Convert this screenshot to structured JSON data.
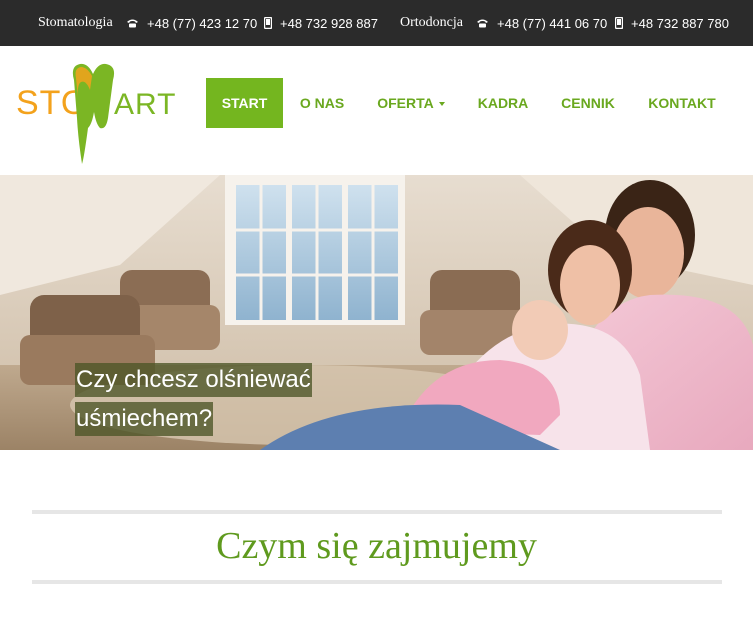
{
  "topbar": {
    "stomatologia_label": "Stomatologia",
    "stomatologia_phone": "+48 (77) 423 12 70",
    "stomatologia_mobile": "+48 732 928 887",
    "ortodoncja_label": "Ortodoncja",
    "ortodoncja_phone": "+48 (77) 441 06 70",
    "ortodoncja_mobile": "+48 732 887 780"
  },
  "logo": {
    "text_left": "STO",
    "text_right": "ART",
    "letter": "M"
  },
  "nav": {
    "items": [
      {
        "label": "START",
        "active": true
      },
      {
        "label": "O NAS"
      },
      {
        "label": "OFERTA",
        "dropdown": true
      },
      {
        "label": "KADRA"
      },
      {
        "label": "CENNIK"
      },
      {
        "label": "KONTAKT"
      }
    ]
  },
  "hero": {
    "caption_line1": "Czy chcesz olśniewać",
    "caption_line2": "uśmiechem?"
  },
  "section": {
    "title": "Czym się zajmujemy"
  },
  "colors": {
    "brand_green": "#74b61f",
    "nav_text": "#6aa81f",
    "topbar_bg": "#2b2b2b",
    "logo_orange": "#f3a21c"
  },
  "icons": {
    "phone": "phone-icon",
    "mobile": "mobile-icon"
  }
}
